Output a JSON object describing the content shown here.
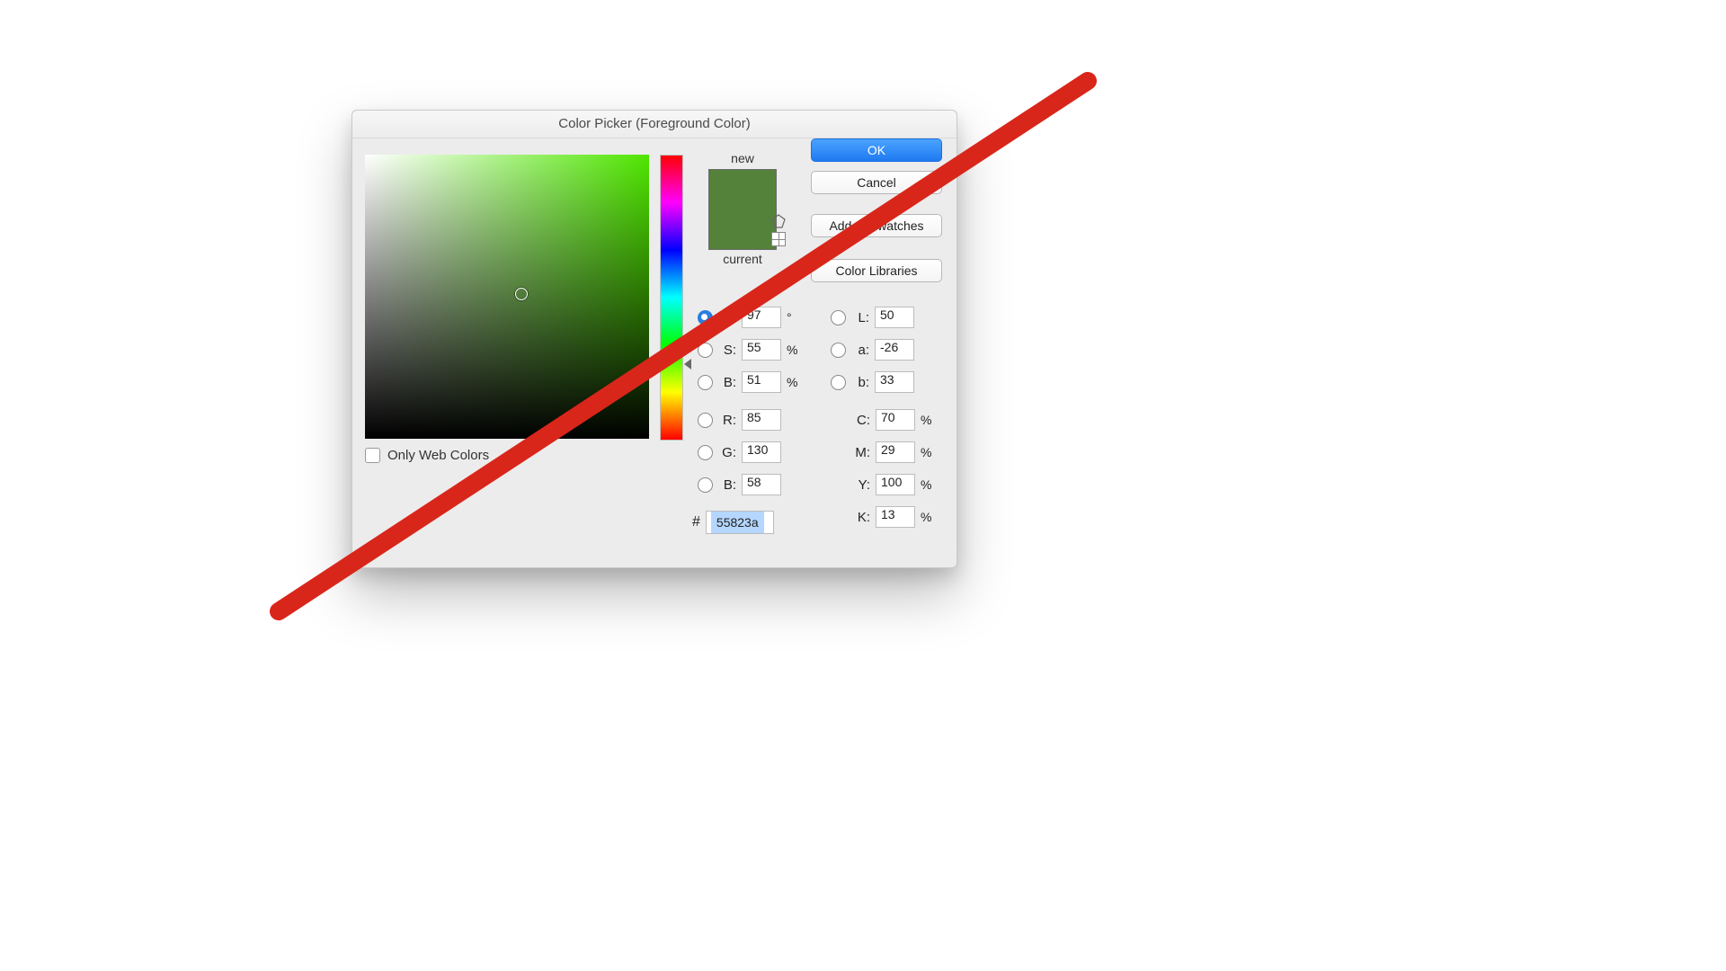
{
  "dialog": {
    "title": "Color Picker (Foreground Color)",
    "ok_label": "OK",
    "cancel_label": "Cancel",
    "add_swatches_label": "Add to Swatches",
    "color_libraries_label": "Color Libraries",
    "only_web_colors_label": "Only Web Colors",
    "only_web_colors_checked": false
  },
  "preview": {
    "new_label": "new",
    "current_label": "current",
    "new_color": "#55823a",
    "current_color": "#55823a"
  },
  "hsb": {
    "selected_channel": "H",
    "H": {
      "label": "H:",
      "value": "97",
      "unit": "°"
    },
    "S": {
      "label": "S:",
      "value": "55",
      "unit": "%"
    },
    "B": {
      "label": "B:",
      "value": "51",
      "unit": "%"
    }
  },
  "rgb": {
    "R": {
      "label": "R:",
      "value": "85"
    },
    "G": {
      "label": "G:",
      "value": "130"
    },
    "B": {
      "label": "B:",
      "value": "58"
    }
  },
  "lab": {
    "L": {
      "label": "L:",
      "value": "50"
    },
    "a": {
      "label": "a:",
      "value": "-26"
    },
    "b": {
      "label": "b:",
      "value": "33"
    }
  },
  "cmyk": {
    "C": {
      "label": "C:",
      "value": "70",
      "unit": "%"
    },
    "M": {
      "label": "M:",
      "value": "29",
      "unit": "%"
    },
    "Y": {
      "label": "Y:",
      "value": "100",
      "unit": "%"
    },
    "K": {
      "label": "K:",
      "value": "13",
      "unit": "%"
    }
  },
  "hex": {
    "prefix": "#",
    "value": "55823a"
  },
  "overlay": {
    "strike_color": "#d9261a"
  }
}
